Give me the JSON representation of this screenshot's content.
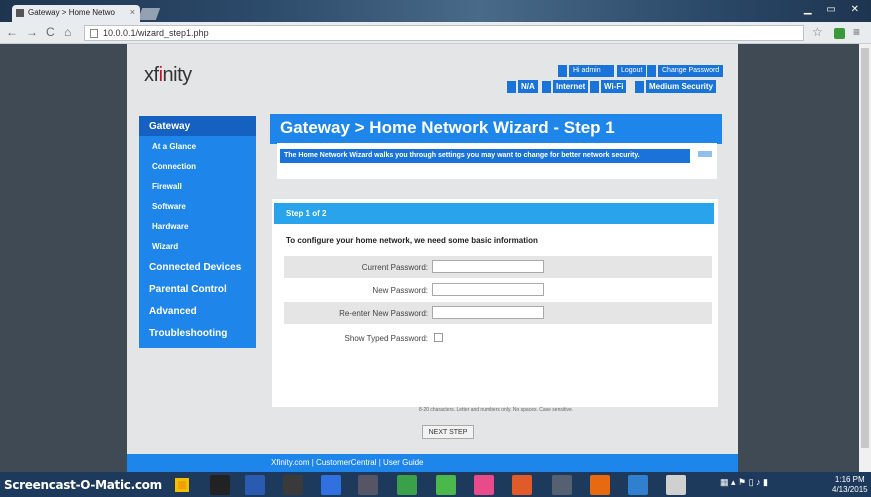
{
  "browser": {
    "tab_title": "Gateway > Home Netwo",
    "tab_close": "×",
    "url": "10.0.0.1/wizard_step1.php",
    "back": "←",
    "forward": "→",
    "reload": "C",
    "home": "⌂",
    "star": "☆",
    "menu": "≡",
    "window_controls": "▁ ▭ ✕"
  },
  "header": {
    "logo_prefix": "xf",
    "logo_accent": "i",
    "logo_suffix": "nity",
    "user_greeting": "Hi admin",
    "logout": "Logout",
    "change_password": "Change Password",
    "status": [
      "N/A",
      "Internet",
      "Wi-Fi",
      "Medium Security"
    ]
  },
  "sidebar": {
    "section": "Gateway",
    "sub_items": [
      "At a Glance",
      "Connection",
      "Firewall",
      "Software",
      "Hardware",
      "Wizard"
    ],
    "main_items": [
      "Connected Devices",
      "Parental Control",
      "Advanced",
      "Troubleshooting"
    ]
  },
  "main": {
    "title": "Gateway > Home Network Wizard - Step 1",
    "info_text": "The Home Network Wizard walks you through settings you may want to change for better network security.",
    "step_header": "Step 1 of 2",
    "intro": "To configure your home network, we need some basic information",
    "fields": {
      "current_password": "Current Password:",
      "new_password": "New Password:",
      "reenter_password": "Re-enter New Password:",
      "show_typed": "Show Typed Password:"
    },
    "hint": "8-20 characters. Letter and numbers only. No spaces. Case sensitive.",
    "next_button": "NEXT STEP"
  },
  "footer": {
    "text": "Xfinity.com  |  CustomerCentral  |  User Guide"
  },
  "taskbar": {
    "watermark": "Screencast-O-Matic.com",
    "tray": "▦  ▴  ⚑  ▯  ♪  ▮",
    "time": "1:16 PM",
    "date": "4/13/2015"
  },
  "colors": {
    "brand_blue": "#1e86ea",
    "dark_blue": "#1560c0",
    "light_blue": "#29a4ec",
    "logo_red": "#c8102e"
  }
}
